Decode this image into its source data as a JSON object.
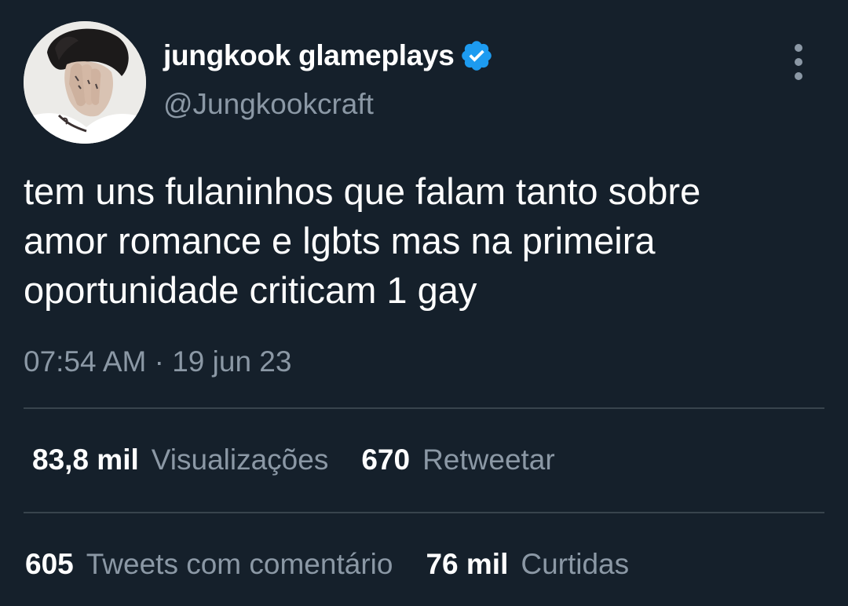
{
  "user": {
    "display_name": "jungkook glameplays",
    "handle": "@Jungkookcraft",
    "verified_icon": "verified-badge-icon",
    "avatar_icon": "avatar"
  },
  "tweet": {
    "text": "tem uns fulaninhos que falam tanto sobre\namor romance e lgbts mas na primeira\noportunidade criticam 1 gay",
    "timestamp": "07:54 AM · 19 jun 23"
  },
  "stats": {
    "views": {
      "count": "83,8 mil",
      "label": "Visualizações"
    },
    "retweets": {
      "count": "670",
      "label": "Retweetar"
    },
    "quotes": {
      "count": "605",
      "label": "Tweets com comentário"
    },
    "likes": {
      "count": "76 mil",
      "label": "Curtidas"
    }
  },
  "menu_icon": "more-vertical-icon",
  "colors": {
    "background": "#15202b",
    "primary_text": "#ffffff",
    "secondary_text": "#8b98a5",
    "divider": "#38444d",
    "verified": "#1d9bf0"
  }
}
